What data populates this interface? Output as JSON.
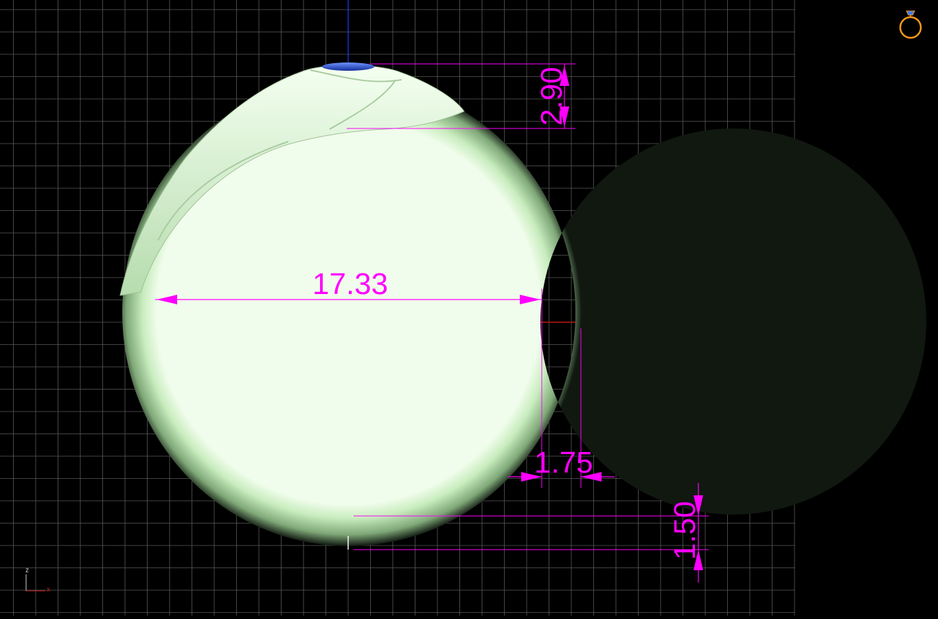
{
  "viewport": {
    "background": "#000000",
    "grid_color": "#5a5a5a",
    "x_axis_color": "#c01818",
    "y_axis_color": "#1a3cff"
  },
  "model": {
    "name": "ring",
    "band_color": "#cdefc4",
    "stone_color": "#1e4fd8"
  },
  "dimensions": {
    "color": "#ff00ff",
    "top_height": "2.90",
    "inner_diameter": "17.33",
    "band_width": "1.75",
    "bottom_thickness": "1.50"
  },
  "axis_triad": {
    "z": "z",
    "x": "x",
    "z_color": "#cfcfcf",
    "x_color": "#d02020"
  },
  "corner_icon": {
    "icon": "ring-icon",
    "color": "#ff9a1a"
  }
}
